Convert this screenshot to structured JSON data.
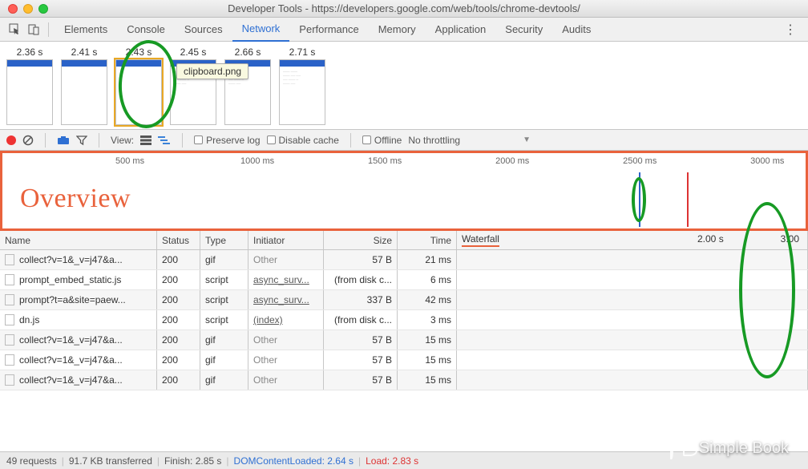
{
  "window": {
    "title": "Developer Tools - https://developers.google.com/web/tools/chrome-devtools/"
  },
  "tabs": {
    "items": [
      "Elements",
      "Console",
      "Sources",
      "Network",
      "Performance",
      "Memory",
      "Application",
      "Security",
      "Audits"
    ],
    "active_index": 3
  },
  "filmstrip": {
    "tooltip": "clipboard.png",
    "frames": [
      {
        "ts": "2.36 s",
        "body": "blank"
      },
      {
        "ts": "2.41 s",
        "body": "blank"
      },
      {
        "ts": "2.43 s",
        "body": "blank",
        "selected": true
      },
      {
        "ts": "2.45 s",
        "body": "text"
      },
      {
        "ts": "2.66 s",
        "body": "text"
      },
      {
        "ts": "2.71 s",
        "body": "text"
      }
    ]
  },
  "toolbar": {
    "view_label": "View:",
    "preserve": "Preserve log",
    "disable": "Disable cache",
    "offline": "Offline",
    "throttling": "No throttling"
  },
  "overview": {
    "label": "Overview",
    "ticks": [
      "500 ms",
      "1000 ms",
      "1500 ms",
      "2000 ms",
      "2500 ms",
      "3000 ms"
    ]
  },
  "table": {
    "headers": {
      "name": "Name",
      "status": "Status",
      "type": "Type",
      "initiator": "Initiator",
      "size": "Size",
      "time": "Time",
      "waterfall": "Waterfall"
    },
    "wf_marker_left": "2.00 s",
    "wf_marker_right": "3.00",
    "rows": [
      {
        "name": "collect?v=1&_v=j47&a...",
        "status": "200",
        "type": "gif",
        "initiator": "Other",
        "init_link": false,
        "size": "57 B",
        "time": "21 ms"
      },
      {
        "name": "prompt_embed_static.js",
        "status": "200",
        "type": "script",
        "initiator": "async_surv...",
        "init_link": true,
        "size": "(from disk c...",
        "time": "6 ms"
      },
      {
        "name": "prompt?t=a&site=paew...",
        "status": "200",
        "type": "script",
        "initiator": "async_surv...",
        "init_link": true,
        "size": "337 B",
        "time": "42 ms"
      },
      {
        "name": "dn.js",
        "status": "200",
        "type": "script",
        "initiator": "(index)",
        "init_link": true,
        "size": "(from disk c...",
        "time": "3 ms"
      },
      {
        "name": "collect?v=1&_v=j47&a...",
        "status": "200",
        "type": "gif",
        "initiator": "Other",
        "init_link": false,
        "size": "57 B",
        "time": "15 ms"
      },
      {
        "name": "collect?v=1&_v=j47&a...",
        "status": "200",
        "type": "gif",
        "initiator": "Other",
        "init_link": false,
        "size": "57 B",
        "time": "15 ms"
      },
      {
        "name": "collect?v=1&_v=j47&a...",
        "status": "200",
        "type": "gif",
        "initiator": "Other",
        "init_link": false,
        "size": "57 B",
        "time": "15 ms"
      }
    ]
  },
  "footer": {
    "requests": "49 requests",
    "transferred": "91.7 KB transferred",
    "finish": "Finish: 2.85 s",
    "dom": "DOMContentLoaded: 2.64 s",
    "load": "Load: 2.83 s"
  },
  "watermark": "Simple Book"
}
